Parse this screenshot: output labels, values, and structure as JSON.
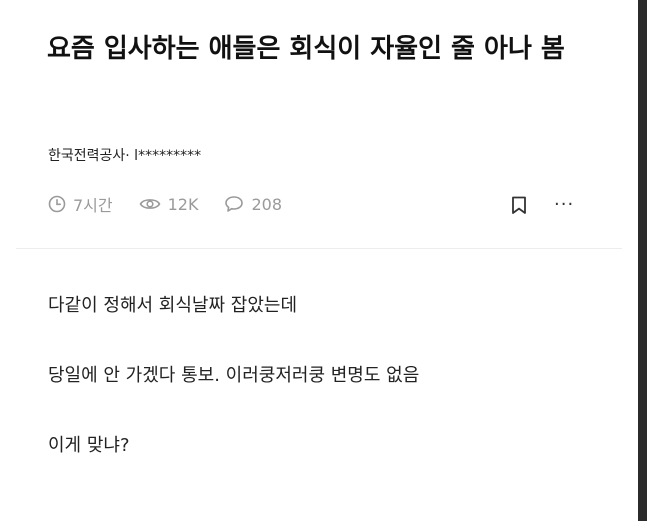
{
  "post": {
    "cut_top_text": "- - - - - -",
    "title": "요즘 입사하는 애들은 회식이 자율인 줄 아나 봄",
    "author": "한국전력공사· l*********",
    "meta": {
      "time": "7시간",
      "views": "12K",
      "comments": "208"
    },
    "icons": {
      "time": "clock-icon",
      "views": "eye-icon",
      "comments": "comment-icon",
      "bookmark": "bookmark-icon",
      "more": "more-icon"
    },
    "more_label": "···",
    "body": [
      "다같이 정해서 회식날짜 잡았는데",
      "당일에 안 가겠다 통보. 이러쿵저러쿵 변명도 없음",
      "이게 맞냐?"
    ]
  }
}
